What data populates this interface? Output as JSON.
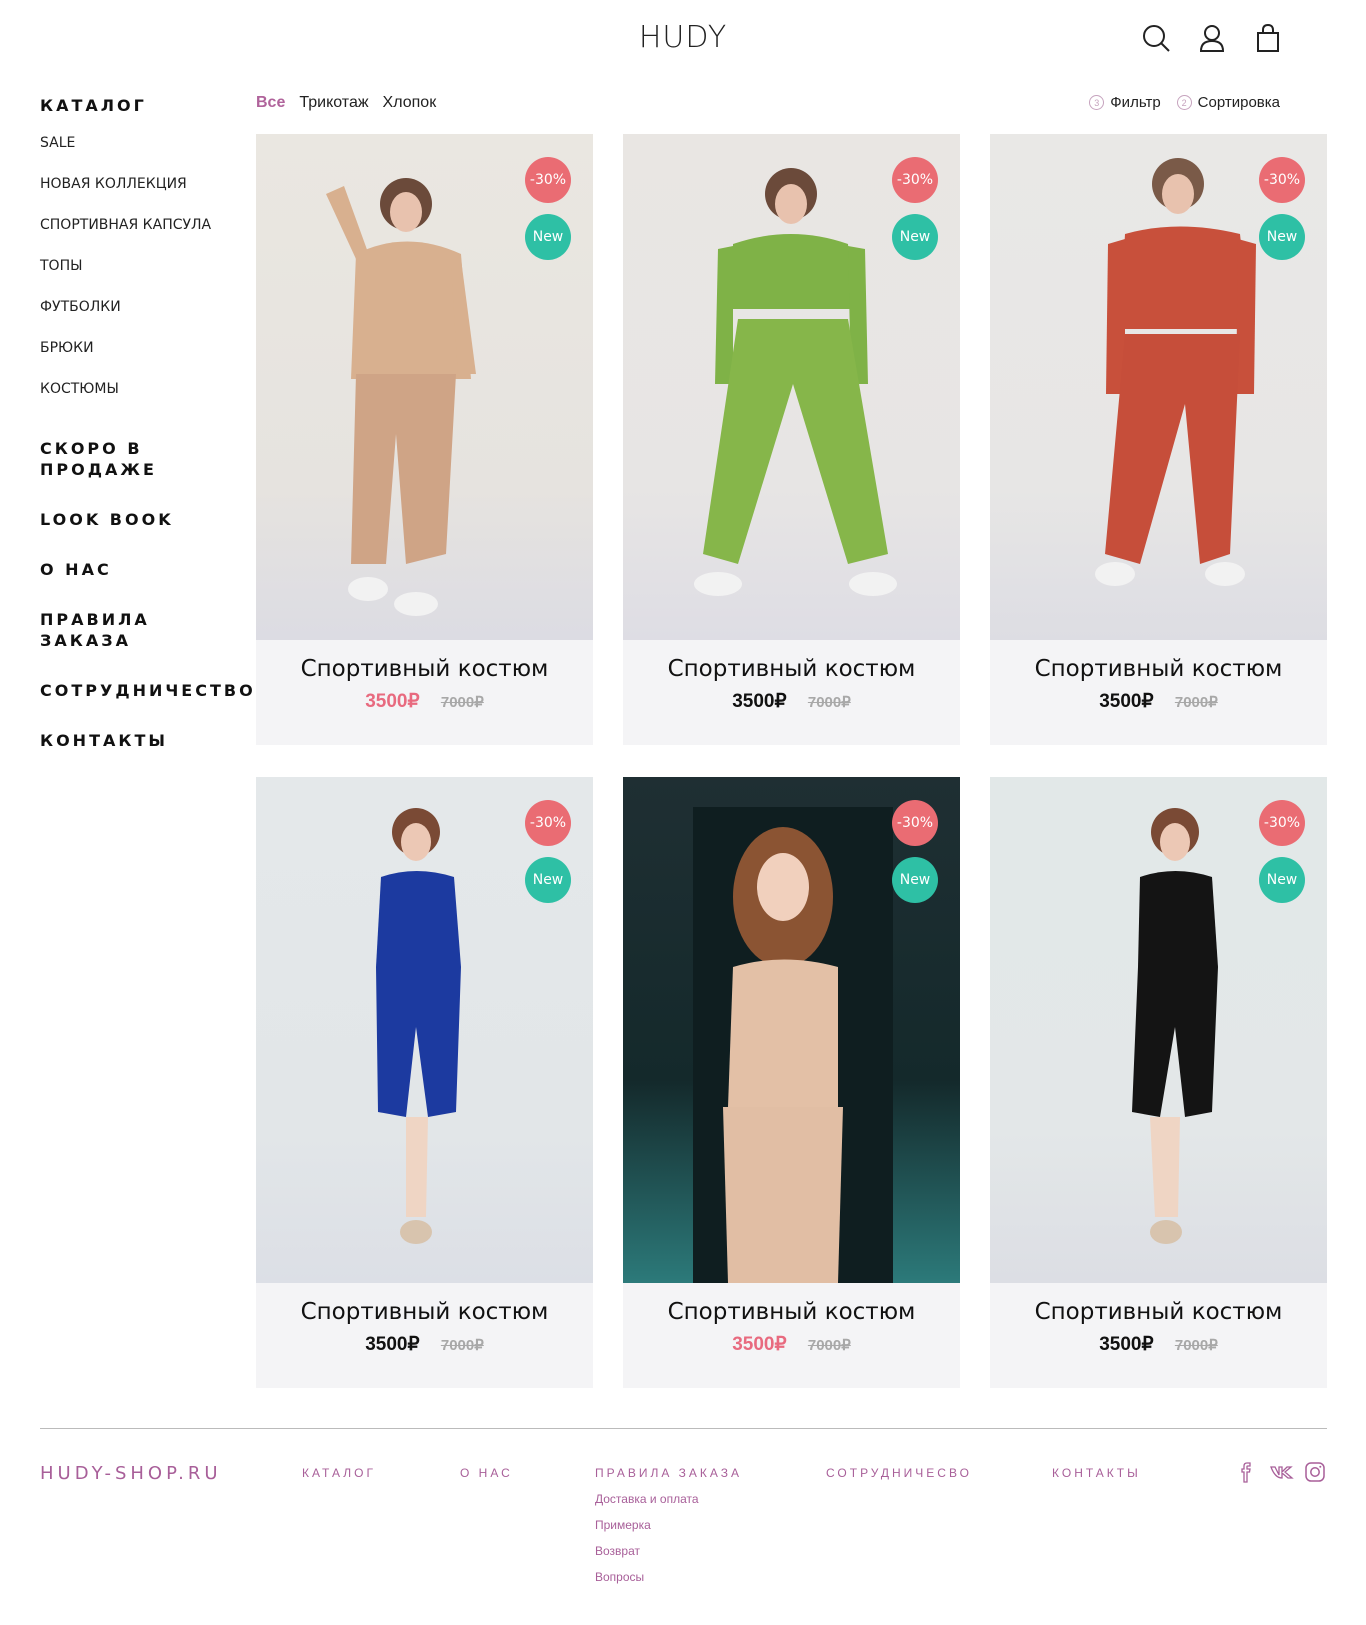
{
  "header": {
    "logo": "HUDY",
    "icons": [
      "search-icon",
      "user-icon",
      "bag-icon"
    ]
  },
  "sidebar": {
    "catalog_heading": "КАТАЛОГ",
    "catalog_items": [
      "SALE",
      "НОВАЯ КОЛЛЕКЦИЯ",
      "СПОРТИВНАЯ КАПСУЛА",
      "ТОПЫ",
      "ФУТБОЛКИ",
      "БРЮКИ",
      "КОСТЮМЫ"
    ],
    "sections": [
      "СКОРО В ПРОДАЖЕ",
      "LOOK BOOK",
      "О НАС",
      "ПРАВИЛА ЗАКАЗА",
      "СОТРУДНИЧЕСТВО",
      "КОНТАКТЫ"
    ]
  },
  "filters": {
    "tags": [
      "Все",
      "Трикотаж",
      "Хлопок"
    ],
    "filter_label": "Фильтр",
    "filter_count": "3",
    "sort_label": "Сортировка",
    "sort_count": "2"
  },
  "products": [
    {
      "title": "Спортивный костюм",
      "price": "3500₽",
      "old_price": "7000₽",
      "sale_badge": "-30%",
      "new_badge": "New",
      "price_highlight": true
    },
    {
      "title": "Спортивный костюм",
      "price": "3500₽",
      "old_price": "7000₽",
      "sale_badge": "-30%",
      "new_badge": "New",
      "price_highlight": false
    },
    {
      "title": "Спортивный костюм",
      "price": "3500₽",
      "old_price": "7000₽",
      "sale_badge": "-30%",
      "new_badge": "New",
      "price_highlight": false
    },
    {
      "title": "Спортивный костюм",
      "price": "3500₽",
      "old_price": "7000₽",
      "sale_badge": "-30%",
      "new_badge": "New",
      "price_highlight": false
    },
    {
      "title": "Спортивный костюм",
      "price": "3500₽",
      "old_price": "7000₽",
      "sale_badge": "-30%",
      "new_badge": "New",
      "price_highlight": true
    },
    {
      "title": "Спортивный костюм",
      "price": "3500₽",
      "old_price": "7000₽",
      "sale_badge": "-30%",
      "new_badge": "New",
      "price_highlight": false
    }
  ],
  "footer": {
    "brand": "HUDY-SHOP.RU",
    "catalog": "КАТАЛОГ",
    "about": "О НАС",
    "rules": "ПРАВИЛА ЗАКАЗА",
    "rules_sub": [
      "Доставка и оплата",
      "Примерка",
      "Возврат",
      "Вопросы"
    ],
    "partnership": "СОТРУДНИЧЕСВО",
    "contacts": "КОНТАКТЫ",
    "social_icons": [
      "facebook-icon",
      "vk-icon",
      "instagram-icon"
    ]
  },
  "colors": {
    "accent": "#a85f99",
    "sale_badge": "#ea6c73",
    "new_badge": "#2ec0a5",
    "sale_price": "#e86a7f"
  }
}
